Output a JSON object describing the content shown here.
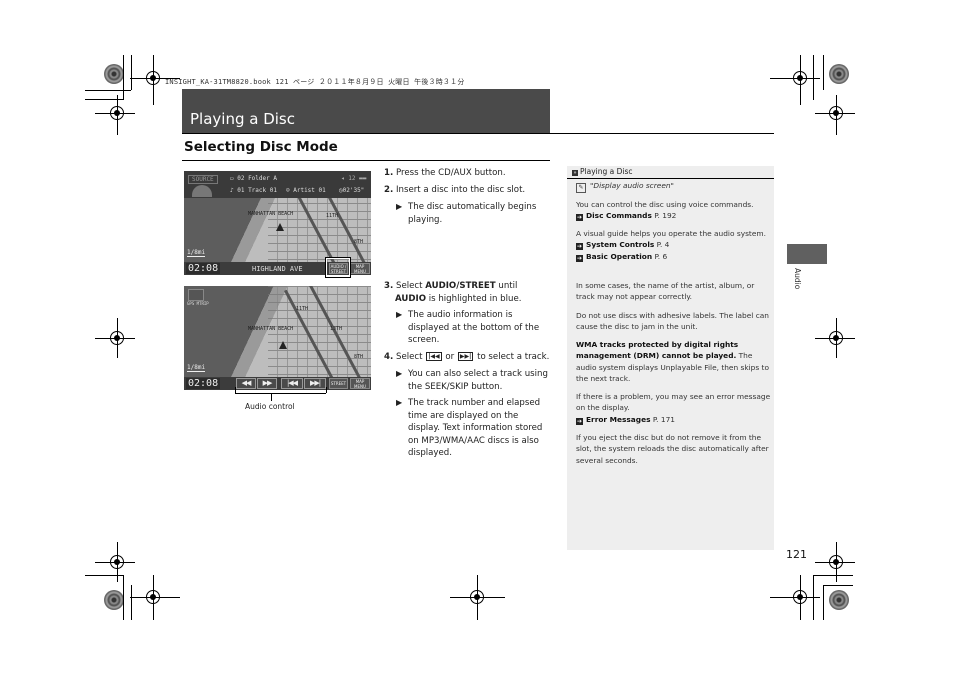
{
  "print_header": "INSIGHT_KA-31TM8820.book  121 ページ  ２０１１年８月９日  火曜日  午後３時３１分",
  "page": {
    "title": "Playing a Disc",
    "section_title": "Selecting Disc Mode",
    "tab_label": "Audio",
    "page_number": "121"
  },
  "screen1": {
    "source_button": "SOURCE",
    "folder": "02 Folder A",
    "track": "01 Track 01",
    "artist": "Artist 01",
    "elapsed": "02'35\"",
    "volume": "12",
    "scale": "1/8mi",
    "clock": "02:08",
    "street": "HIGHLAND AVE",
    "audio_street_button": "AUDIO / STREET",
    "map_menu_button": "MAP MENU",
    "map_labels": [
      "MANHATTAN BEACH",
      "11TH",
      "8TH"
    ]
  },
  "screen2": {
    "gps_button": "GPS MTRIP",
    "scale": "1/8mi",
    "clock": "02:08",
    "controls": [
      {
        "name": "rewind",
        "glyph": "◀◀"
      },
      {
        "name": "fast-forward",
        "glyph": "▶▶"
      },
      {
        "name": "skip-back",
        "glyph": "|◀◀"
      },
      {
        "name": "skip-forward",
        "glyph": "▶▶|"
      }
    ],
    "audio_street_button": "STREET",
    "map_menu_button": "MAP MENU",
    "map_labels": [
      "MANHATTAN BEACH",
      "13TH",
      "11TH",
      "8TH"
    ],
    "callout_label": "Audio control"
  },
  "steps": [
    {
      "num": "1.",
      "text": "Press the CD/AUX button."
    },
    {
      "num": "2.",
      "text": "Insert a disc into the disc slot."
    },
    {
      "sub": "The disc automatically begins playing."
    },
    {
      "num": "3.",
      "pre": "Select ",
      "bold1": "AUDIO/STREET",
      "mid": " until ",
      "bold2": "AUDIO",
      "post": " is highlighted in blue."
    },
    {
      "sub": "The audio information is displayed at the bottom of the screen."
    },
    {
      "num": "4.",
      "pre": "Select ",
      "icon1": "|◀◀",
      "mid": " or ",
      "icon2": "▶▶|",
      "post": " to select a track."
    },
    {
      "sub": "You can also select a track using the SEEK/SKIP button."
    },
    {
      "sub": "The track number and elapsed time are displayed on the display. Text information stored on MP3/WMA/AAC discs is also displayed."
    }
  ],
  "side_panel": {
    "heading": "Playing a Disc",
    "voice_command": "\"Display audio screen\"",
    "p1": "You can control the disc using voice commands.",
    "ref1": {
      "label": "Disc Commands",
      "page": "P. 192"
    },
    "p2": "A visual guide helps you operate the audio system.",
    "ref2": {
      "label": "System Controls",
      "page": "P. 4"
    },
    "ref3": {
      "label": "Basic Operation",
      "page": "P. 6"
    },
    "p3": "In some cases, the name of the artist, album, or track may not appear correctly.",
    "p4": "Do not use discs with adhesive labels. The label can cause the disc to jam in the unit.",
    "p5_bold": "WMA tracks protected by digital rights management (DRM) cannot be played.",
    "p5_rest": " The audio system displays Unplayable File, then skips to the next track.",
    "p6": "If there is a problem, you may see an error message on the display.",
    "ref4": {
      "label": "Error Messages",
      "page": "P. 171"
    },
    "p7": "If you eject the disc but do not remove it from the slot, the system reloads the disc automatically after several seconds."
  }
}
